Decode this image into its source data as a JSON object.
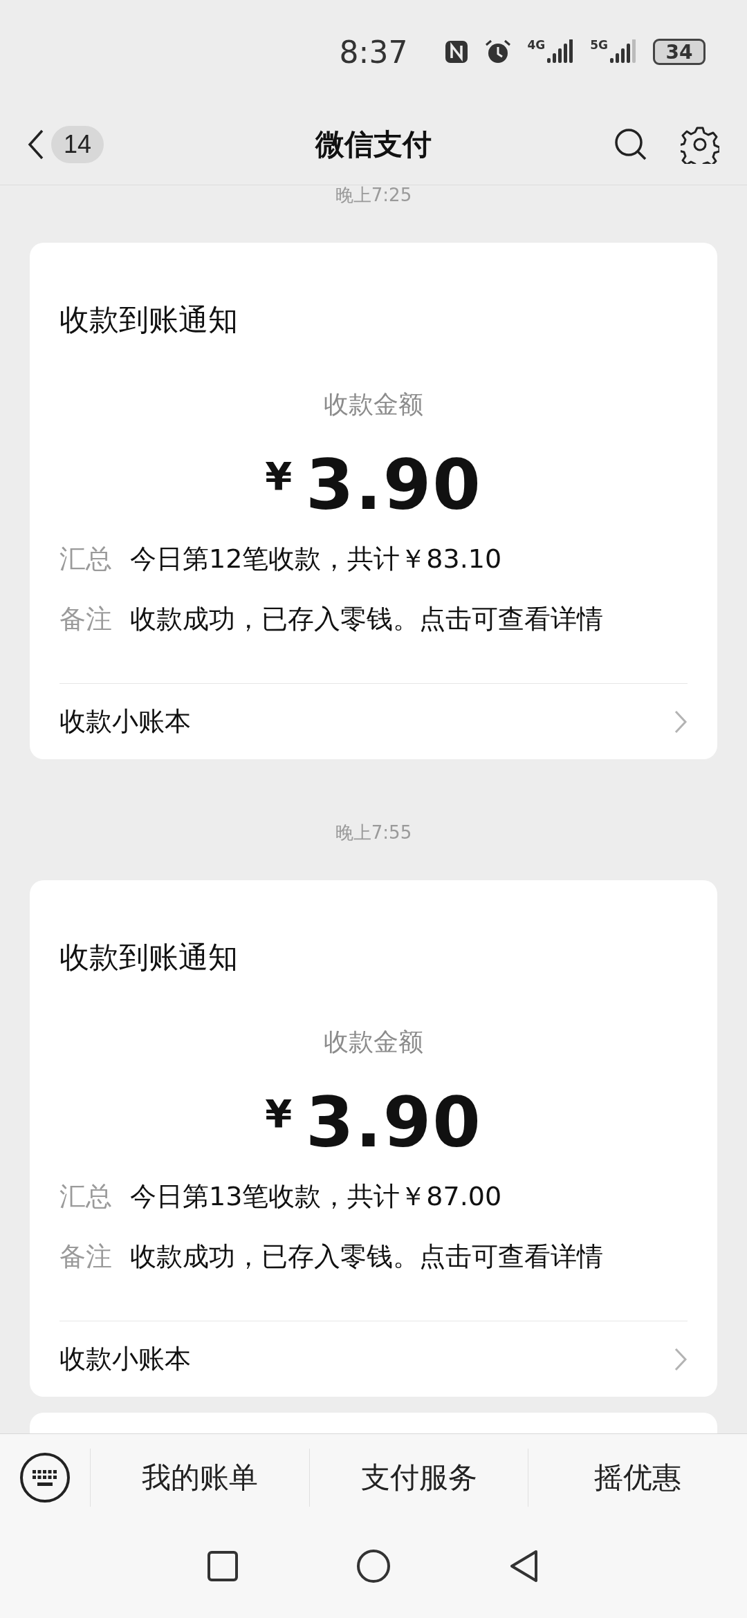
{
  "status_bar": {
    "time": "8:37",
    "signals": [
      {
        "label": "4G"
      },
      {
        "label": "5G"
      }
    ],
    "battery": "34"
  },
  "header": {
    "title": "微信支付",
    "unread_count": "14"
  },
  "messages": [
    {
      "time": "晚上7:25",
      "title": "收款到账通知",
      "amount_label": "收款金额",
      "currency": "¥",
      "amount": "3.90",
      "fields": [
        {
          "label": "汇总",
          "value": "今日第12笔收款，共计￥83.10"
        },
        {
          "label": "备注",
          "value": "收款成功，已存入零钱。点击可查看详情"
        }
      ],
      "link": "收款小账本"
    },
    {
      "time": "晚上7:55",
      "title": "收款到账通知",
      "amount_label": "收款金额",
      "currency": "¥",
      "amount": "3.90",
      "fields": [
        {
          "label": "汇总",
          "value": "今日第13笔收款，共计￥87.00"
        },
        {
          "label": "备注",
          "value": "收款成功，已存入零钱。点击可查看详情"
        }
      ],
      "link": "收款小账本"
    }
  ],
  "menu": [
    "我的账单",
    "支付服务",
    "摇优惠"
  ]
}
